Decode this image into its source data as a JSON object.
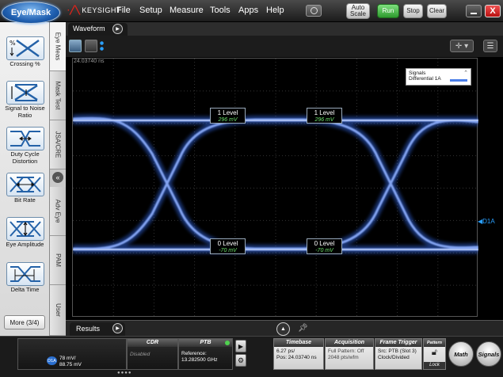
{
  "app": {
    "mode_button": "Eye/Mask",
    "brand": "KEYSIGHT"
  },
  "menu": [
    "File",
    "Setup",
    "Measure",
    "Tools",
    "Apps",
    "Help"
  ],
  "toolbar": {
    "auto_scale": "Auto Scale",
    "run": "Run",
    "stop": "Stop",
    "clear": "Clear",
    "close": "X"
  },
  "measurements": [
    {
      "label": "Crossing %",
      "icon": "crossing-percent-icon"
    },
    {
      "label": "Signal to Noise Ratio",
      "icon": "snr-icon"
    },
    {
      "label": "Duty Cycle Distortion",
      "icon": "duty-cycle-icon"
    },
    {
      "label": "Bit Rate",
      "icon": "bit-rate-icon"
    },
    {
      "label": "Eye Amplitude",
      "icon": "eye-amplitude-icon"
    },
    {
      "label": "Delta Time",
      "icon": "delta-time-icon"
    }
  ],
  "more_button": "More (3/4)",
  "side_tabs": [
    "Eye Meas",
    "Mask Test",
    "JSA/CRE",
    "Adv Eye",
    "PAM",
    "User"
  ],
  "waveform": {
    "tab_label": "Waveform",
    "position_readout": "24.03740 ns",
    "legend_title": "Signals",
    "legend_entry": "Differential 1A",
    "channel_marker": "D1A",
    "levels": [
      {
        "title": "1 Level",
        "value": "296 mV"
      },
      {
        "title": "1 Level",
        "value": "296 mV"
      },
      {
        "title": "0 Level",
        "value": "-70 mV"
      },
      {
        "title": "0 Level",
        "value": "-70 mV"
      }
    ]
  },
  "results_tab": "Results",
  "status": {
    "channel_badge": "D1A",
    "channel_scale": "78 mV/",
    "channel_offset": "88.75 mV",
    "cdr_title": "CDR",
    "cdr_state": "Disabled",
    "ptb_title": "PTB",
    "ptb_reference_label": "Reference:",
    "ptb_reference_value": "13.282500 GHz",
    "timebase_title": "Timebase",
    "timebase_scale": "6.27 ps/",
    "timebase_pos": "Pos: 24.03740 ns",
    "acquisition_title": "Acquisition",
    "acquisition_pattern": "Full Pattern: Off",
    "acquisition_rate": "2048 pts/wfm",
    "frame_trigger_title": "Frame Trigger",
    "frame_trigger_src": "Src: PTB (Slot 3)",
    "frame_trigger_mode": "Clock/Divided",
    "pattern_title": "Pattern",
    "lock_label": "Lock",
    "math_button": "Math",
    "signals_button": "Signals"
  }
}
